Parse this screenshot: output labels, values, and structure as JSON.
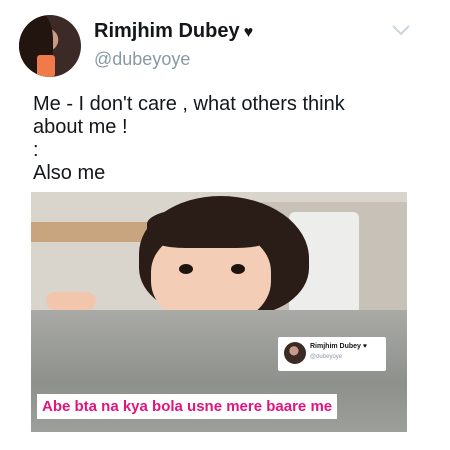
{
  "tweet": {
    "display_name": "Rimjhim Dubey",
    "handle": "@dubeyoye",
    "text": "Me - I don't care , what others think\nabout me !\n:\nAlso me"
  },
  "media": {
    "embedded_tweet": {
      "display_name": "Rimjhim Dubey",
      "handle": "@dubeyoye"
    },
    "caption": "Abe bta na kya bola usne mere baare me"
  },
  "colors": {
    "handle_gray": "#8899a6",
    "caption_pink": "#e0157d"
  },
  "icons": {
    "verified_like": "heart-icon",
    "menu": "chevron-down-icon"
  }
}
